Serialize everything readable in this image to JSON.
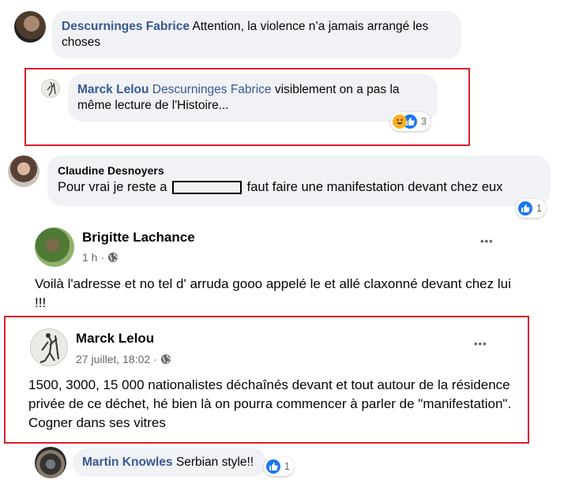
{
  "comments": [
    {
      "author": "Descurninges Fabrice",
      "text": "Attention, la violence n’a jamais arrangé les choses"
    },
    {
      "author": "Marck Lelou",
      "tag": "Descurninges Fabrice",
      "text": "visiblement on a pas la même lecture de l'Histoire...",
      "reaction_count": "3"
    },
    {
      "author": "Claudine Desnoyers",
      "text_before": "Pour vrai je reste a",
      "text_after": "faut faire une manifestation devant chez eux",
      "reaction_count": "1"
    }
  ],
  "posts": [
    {
      "author": "Brigitte Lachance",
      "time": "1 h",
      "text": "Voilà l'adresse et no tel d' arruda gooo appelé le et allé claxonné devant chez lui !!!"
    },
    {
      "author": "Marck Lelou",
      "time": "27 juillet, 18:02",
      "text": "1500, 3000, 15 000 nationalistes déchaînés devant et tout autour de la résidence privée de ce déchet, hé bien là on pourra commencer à parler de \"manifestation\". Cogner dans ses vitres"
    }
  ],
  "reply": {
    "author": "Martin Knowles",
    "text": "Serbian style!!",
    "reaction_count": "1"
  },
  "symbols": {
    "separator": "·",
    "more": "•••"
  },
  "colors": {
    "highlight_border": "#d9202a",
    "name_link": "#385898",
    "like_blue": "#1877f2"
  },
  "icons": [
    "globe-icon",
    "like-icon",
    "haha-icon",
    "more-options-icon"
  ]
}
